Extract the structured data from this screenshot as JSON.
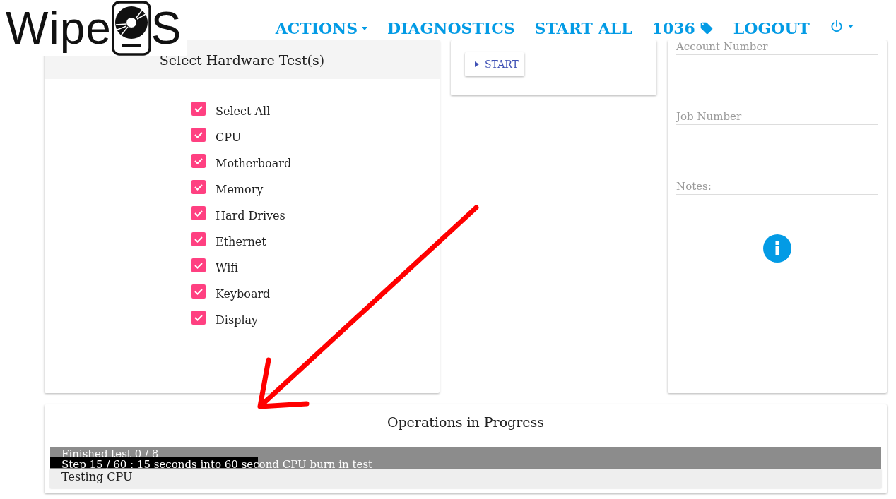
{
  "logo": {
    "before": "Wipe",
    "after": "S"
  },
  "nav": [
    {
      "kind": "menu",
      "label": "ACTIONS"
    },
    {
      "kind": "link",
      "label": "DIAGNOSTICS"
    },
    {
      "kind": "link",
      "label": "START ALL"
    },
    {
      "kind": "tag",
      "label": "1036"
    },
    {
      "kind": "link",
      "label": "LOGOUT"
    },
    {
      "kind": "power"
    }
  ],
  "tests_panel": {
    "title": "Select Hardware Test(s)",
    "items": [
      {
        "label": "Select All",
        "checked": true
      },
      {
        "label": "CPU",
        "checked": true
      },
      {
        "label": "Motherboard",
        "checked": true
      },
      {
        "label": "Memory",
        "checked": true
      },
      {
        "label": "Hard Drives",
        "checked": true
      },
      {
        "label": "Ethernet",
        "checked": true
      },
      {
        "label": "Wifi",
        "checked": true
      },
      {
        "label": "Keyboard",
        "checked": true
      },
      {
        "label": "Display",
        "checked": true
      }
    ]
  },
  "start_button": {
    "label": "START"
  },
  "form": {
    "fields": [
      {
        "placeholder": "Account Number"
      },
      {
        "placeholder": "Job Number"
      },
      {
        "placeholder": "Notes:"
      }
    ]
  },
  "operations": {
    "title": "Operations in Progress",
    "bars": [
      {
        "text": "Finished test 0 / 8"
      },
      {
        "text": "Step 15 / 60 : 15 seconds into 60 second CPU burn in test",
        "level": 0.25
      }
    ],
    "status": "Testing CPU"
  }
}
